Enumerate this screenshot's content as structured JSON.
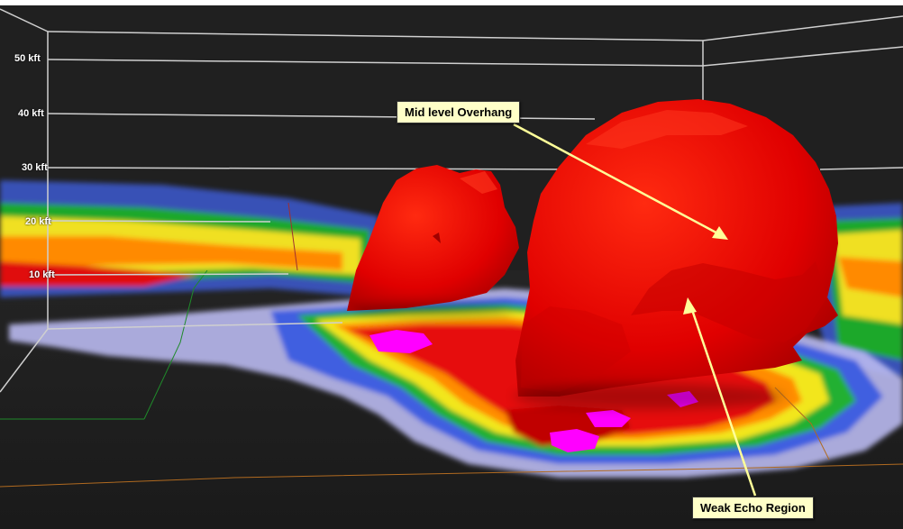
{
  "altitude_labels": [
    "50 kft",
    "40 kft",
    "30 kft",
    "20 kft",
    "10 kft"
  ],
  "annotations": {
    "overhang": "Mid level Overhang",
    "weak_echo": "Weak Echo Region"
  },
  "colors": {
    "background": "#1e1e1e",
    "storm_core": "#e00000",
    "callout_fill": "#ffffc8",
    "arrow": "#ffff99",
    "grid_line": "#cfcfcf"
  }
}
